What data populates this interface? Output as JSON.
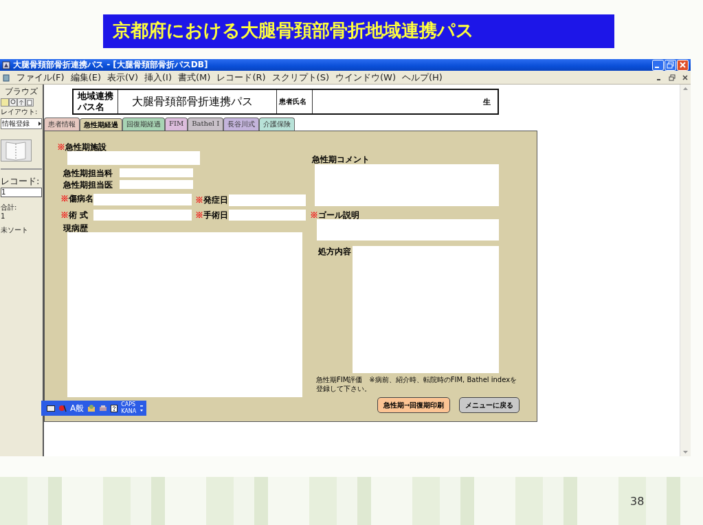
{
  "slide": {
    "title": "京都府における大腿骨頚部骨折地域連携パス",
    "page_number": "38"
  },
  "window": {
    "title": "大腿骨頚部骨折連携パス - [大腿骨頚部骨折パスDB]"
  },
  "menu": [
    "ファイル(F)",
    "編集(E)",
    "表示(V)",
    "挿入(I)",
    "書式(M)",
    "レコード(R)",
    "スクリプト(S)",
    "ウインドウ(W)",
    "ヘルプ(H)"
  ],
  "status_panel": {
    "mode": "ブラウズ",
    "layout_label": "レイアウト:",
    "layout_value": "情報登録",
    "record_label": "レコード:",
    "record_value": "1",
    "total_label": "合計:",
    "total_value": "1",
    "sort": "未ソート"
  },
  "header": {
    "path_label": "地域連携パス名",
    "path_value": "大腿骨頚部骨折連携パス",
    "patient_label": "患者氏名",
    "birth_suffix": "生"
  },
  "tabs": [
    {
      "label": "患者情報",
      "selected": false,
      "color": "#e6c8c0"
    },
    {
      "label": "急性期経過",
      "selected": true,
      "color": "#d8cfa8"
    },
    {
      "label": "回復期経過",
      "selected": false,
      "color": "#a8d4b4"
    },
    {
      "label": "FIM",
      "selected": false,
      "color": "#dcbcdc"
    },
    {
      "label": "Bathel I",
      "selected": false,
      "color": "#c8c0c8"
    },
    {
      "label": "長谷川式",
      "selected": false,
      "color": "#c4b4dc"
    },
    {
      "label": "介護保険",
      "selected": false,
      "color": "#b8e2d8"
    }
  ],
  "fields": [
    {
      "mark": "※",
      "label": "急性期施設"
    },
    {
      "label": "急性期担当科"
    },
    {
      "label": "急性期担当医"
    },
    {
      "mark": "※",
      "label": "傷病名"
    },
    {
      "mark": "※",
      "label": "発症日"
    },
    {
      "mark": "※",
      "label": "術 式"
    },
    {
      "mark": "※",
      "label": "手術日"
    },
    {
      "label": "現病歴"
    },
    {
      "label": "急性期コメント"
    },
    {
      "mark": "※",
      "label": "ゴール説明"
    },
    {
      "label": "処方内容"
    }
  ],
  "note": "急性期FIM評価　※病前、紹介時、転院時のFIM, Bathel indexを登録して下さい。",
  "buttons": [
    {
      "label": "急性期→回復期印刷",
      "kind": "primary"
    },
    {
      "label": "メニューに戻る",
      "kind": "secondary"
    }
  ],
  "ime_bar": {
    "mode": "A般",
    "caps": "CAPS",
    "kana": "KANA"
  }
}
